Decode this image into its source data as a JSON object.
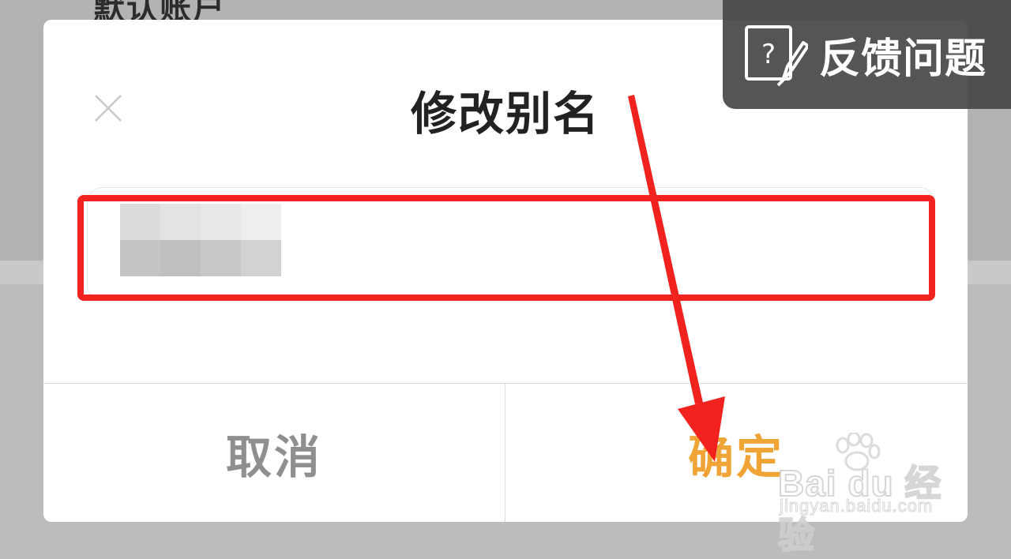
{
  "background": {
    "header_text": "默认账户"
  },
  "dialog": {
    "title": "修改别名",
    "close_icon": "close-icon",
    "input": {
      "value_state": "blurred",
      "highlight_color": "#f2231f"
    },
    "cancel_label": "取消",
    "confirm_label": "确定"
  },
  "feedback": {
    "label": "反馈问题",
    "icon": "feedback-edit-icon"
  },
  "annotation": {
    "arrow_color": "#f2231f"
  },
  "watermark": {
    "brand": "Bai du 经验",
    "url": "jingyan.baidu.com"
  },
  "colors": {
    "accent": "#f0a436",
    "cancel": "#8f8f8f",
    "annotation": "#f2231f"
  }
}
